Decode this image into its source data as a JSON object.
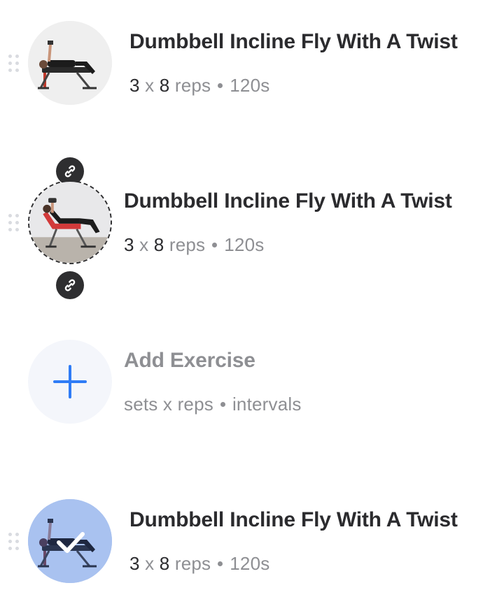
{
  "exercises": [
    {
      "name": "Dumbbell Incline Fly With A Twist",
      "sets": "3",
      "x": "x",
      "reps_count": "8",
      "reps_label": "reps",
      "rest": "120s",
      "state": "normal"
    },
    {
      "name": "Dumbbell Incline Fly With A Twist",
      "sets": "3",
      "x": "x",
      "reps_count": "8",
      "reps_label": "reps",
      "rest": "120s",
      "state": "superset-linked"
    },
    {
      "name": "Dumbbell Incline Fly With A Twist",
      "sets": "3",
      "x": "x",
      "reps_count": "8",
      "reps_label": "reps",
      "rest": "120s",
      "state": "completed"
    }
  ],
  "add_exercise": {
    "title": "Add Exercise",
    "sets_label": "sets",
    "x": "x",
    "reps_label": "reps",
    "intervals_label": "intervals"
  },
  "icons": {
    "drag": "drag-handle-icon",
    "link": "link-icon",
    "plus": "plus-icon",
    "check": "checkmark-icon"
  },
  "colors": {
    "accent": "#2f7cf6",
    "completed_overlay": "#a9c2f0",
    "link_badge": "#2e2e30"
  }
}
